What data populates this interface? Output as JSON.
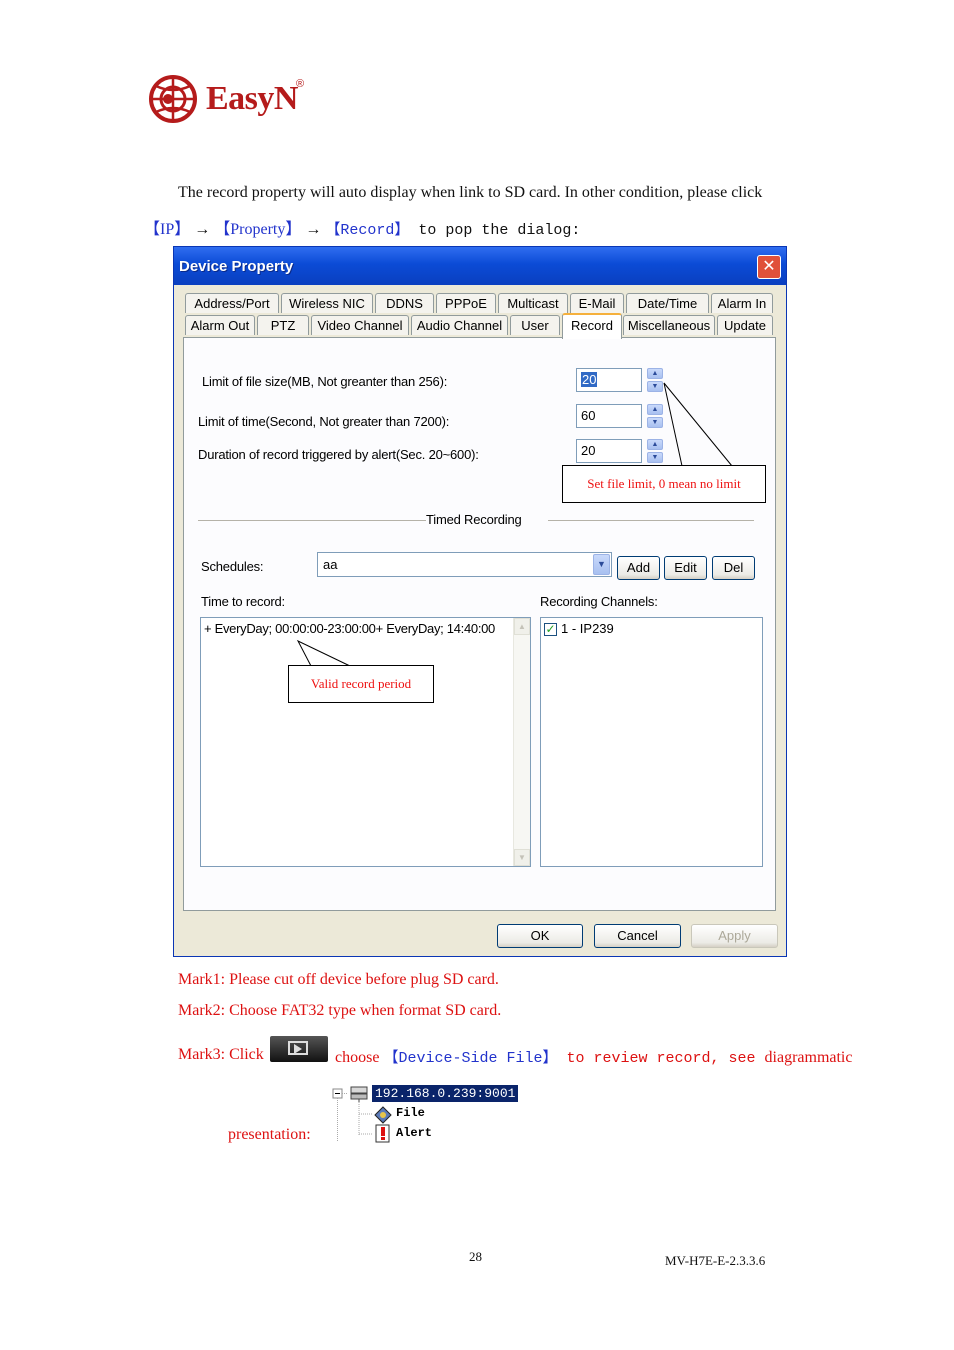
{
  "logo": {
    "brand": "EasyN",
    "reg": "®"
  },
  "intro": {
    "line1": "The record property will auto display when link to SD card. In other condition, please click",
    "ip": "【IP】",
    "arrow1": " → ",
    "property": "【Property】",
    "arrow2": " → ",
    "record": "【Record】",
    "tail": " to pop the dialog:"
  },
  "dialog": {
    "title": "Device Property",
    "close_symbol": "✕",
    "tabs_row1": [
      "Address/Port",
      "Wireless NIC",
      "DDNS",
      "PPPoE",
      "Multicast",
      "E-Mail",
      "Date/Time",
      "Alarm In"
    ],
    "tabs_row2": [
      "Alarm Out",
      "PTZ",
      "Video Channel",
      "Audio Channel",
      "User",
      "Record",
      "Miscellaneous",
      "Update"
    ],
    "active_tab": "Record",
    "fields": {
      "file_size_label": "Limit of file size(MB, Not greanter than 256):",
      "file_size_value": "20",
      "time_label": "Limit of time(Second, Not greater than 7200):",
      "time_value": "60",
      "duration_label": "Duration of record triggered by alert(Sec. 20~600):",
      "duration_value": "20"
    },
    "callout_file_limit": "Set file limit, 0 mean no limit",
    "timed_recording": "Timed Recording",
    "schedules_label": "Schedules:",
    "schedules_value": "aa",
    "add_button": "Add",
    "edit_button": "Edit",
    "del_button": "Del",
    "time_to_record_label": "Time to record:",
    "time_to_record_item": "+ EveryDay; 00:00:00-23:00:00+ EveryDay; 14:40:00",
    "recording_channels_label": "Recording Channels:",
    "channel_item": "1 - IP239",
    "channel_checked": true,
    "callout_valid_period": "Valid record period",
    "ok_button": "OK",
    "cancel_button": "Cancel",
    "apply_button": "Apply"
  },
  "marks": {
    "mark1": "Mark1: Please cut off device before plug SD card.",
    "mark2": "Mark2: Choose FAT32 type when format SD card.",
    "mark3_prefix": "Mark3: Click",
    "mark3_choose": "choose",
    "mark3_device_side": "【Device-Side File】",
    "mark3_review": " to review record, see ",
    "mark3_diag": "diagrammatic",
    "presentation": "presentation:"
  },
  "tree": {
    "root": "192.168.0.239:9001",
    "file": "File",
    "alert": "Alert"
  },
  "footer": {
    "page_number": "28",
    "doc_code": "MV-H7E-E-2.3.3.6"
  }
}
